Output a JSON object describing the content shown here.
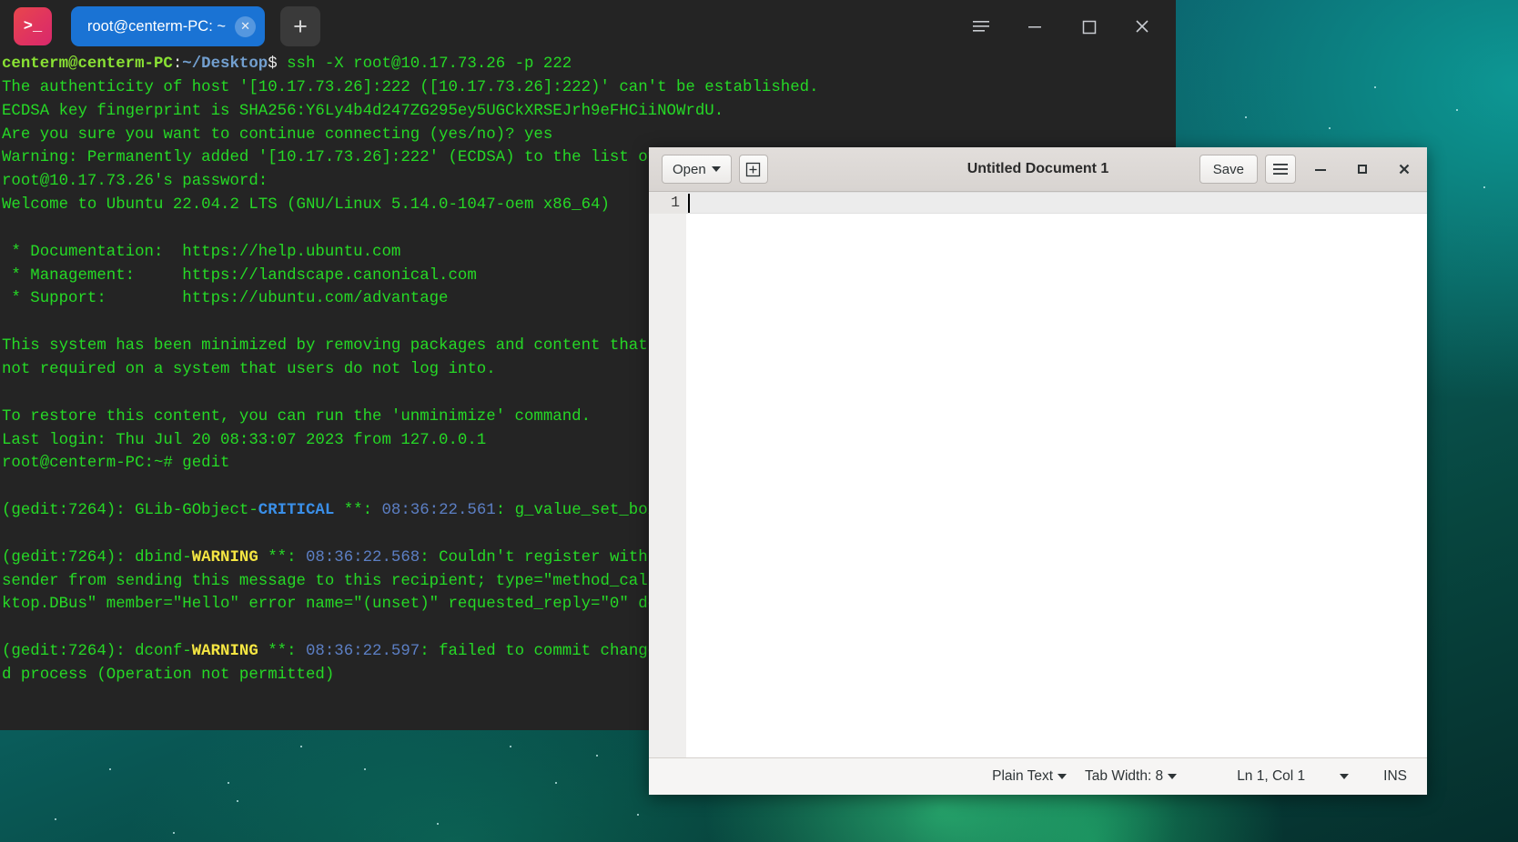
{
  "desktop": {
    "wallpaper_name": "aurora-wallpaper"
  },
  "terminal": {
    "app_icon": "terminal-icon",
    "icon_glyph": ">_",
    "tab": {
      "label": "root@centerm-PC: ~",
      "close_icon": "close-icon"
    },
    "new_tab_label": "+",
    "window_buttons": {
      "menu": "hamburger-menu-icon",
      "minimize": "minimize-icon",
      "maximize": "maximize-icon",
      "close": "close-icon"
    },
    "lines": [
      {
        "segments": [
          {
            "t": "centerm@centerm-PC",
            "c": "c-user"
          },
          {
            "t": ":",
            "c": "c-white"
          },
          {
            "t": "~/Desktop",
            "c": "c-path"
          },
          {
            "t": "$",
            "c": "c-white"
          },
          {
            "t": " ssh -X root@10.17.73.26 -p 222",
            "c": "c-green"
          }
        ]
      },
      {
        "segments": [
          {
            "t": "The authenticity of host '[10.17.73.26]:222 ([10.17.73.26]:222)' can't be established.",
            "c": "c-green"
          }
        ]
      },
      {
        "segments": [
          {
            "t": "ECDSA key fingerprint is SHA256:Y6Ly4b4d247ZG295ey5UGCkXRSEJrh9eFHCiiNOWrdU.",
            "c": "c-green"
          }
        ]
      },
      {
        "segments": [
          {
            "t": "Are you sure you want to continue connecting (yes/no)? yes",
            "c": "c-green"
          }
        ]
      },
      {
        "segments": [
          {
            "t": "Warning: Permanently added '[10.17.73.26]:222' (ECDSA) to the list of known hosts.",
            "c": "c-green"
          }
        ]
      },
      {
        "segments": [
          {
            "t": "root@10.17.73.26's password:",
            "c": "c-green"
          }
        ]
      },
      {
        "segments": [
          {
            "t": "Welcome to Ubuntu 22.04.2 LTS (GNU/Linux 5.14.0-1047-oem x86_64)",
            "c": "c-green"
          }
        ]
      },
      {
        "segments": [
          {
            "t": "",
            "c": "c-green"
          }
        ]
      },
      {
        "segments": [
          {
            "t": " * Documentation:  https://help.ubuntu.com",
            "c": "c-green"
          }
        ]
      },
      {
        "segments": [
          {
            "t": " * Management:     https://landscape.canonical.com",
            "c": "c-green"
          }
        ]
      },
      {
        "segments": [
          {
            "t": " * Support:        https://ubuntu.com/advantage",
            "c": "c-green"
          }
        ]
      },
      {
        "segments": [
          {
            "t": "",
            "c": "c-green"
          }
        ]
      },
      {
        "segments": [
          {
            "t": "This system has been minimized by removing packages and content that are",
            "c": "c-green"
          }
        ]
      },
      {
        "segments": [
          {
            "t": "not required on a system that users do not log into.",
            "c": "c-green"
          }
        ]
      },
      {
        "segments": [
          {
            "t": "",
            "c": "c-green"
          }
        ]
      },
      {
        "segments": [
          {
            "t": "To restore this content, you can run the 'unminimize' command.",
            "c": "c-green"
          }
        ]
      },
      {
        "segments": [
          {
            "t": "Last login: Thu Jul 20 08:33:07 2023 from 127.0.0.1",
            "c": "c-green"
          }
        ]
      },
      {
        "segments": [
          {
            "t": "root@centerm-PC:~# gedit",
            "c": "c-green"
          }
        ]
      },
      {
        "segments": [
          {
            "t": "",
            "c": "c-green"
          }
        ]
      },
      {
        "segments": [
          {
            "t": "(gedit:7264): GLib-GObject-",
            "c": "c-green"
          },
          {
            "t": "CRITICAL",
            "c": "c-blue-b"
          },
          {
            "t": " **: ",
            "c": "c-green"
          },
          {
            "t": "08:36:22.561",
            "c": "c-time"
          },
          {
            "t": ": g_value_set_boxed: assertion 'G_VALUE",
            "c": "c-green"
          }
        ]
      },
      {
        "segments": [
          {
            "t": "",
            "c": "c-green"
          }
        ]
      },
      {
        "segments": [
          {
            "t": "(gedit:7264): dbind-",
            "c": "c-green"
          },
          {
            "t": "WARNING",
            "c": "c-yellow-b"
          },
          {
            "t": " **: ",
            "c": "c-green"
          },
          {
            "t": "08:36:22.568",
            "c": "c-time"
          },
          {
            "t": ": Couldn't register with accessibility bus",
            "c": "c-green"
          }
        ]
      },
      {
        "segments": [
          {
            "t": "sender from sending this message to this recipient; type=\"method_call\", sender=",
            "c": "c-green"
          }
        ]
      },
      {
        "segments": [
          {
            "t": "ktop.DBus\" member=\"Hello\" error name=\"(unset)\" requested_reply=\"0\" destinat",
            "c": "c-green"
          }
        ]
      },
      {
        "segments": [
          {
            "t": "",
            "c": "c-green"
          }
        ]
      },
      {
        "segments": [
          {
            "t": "(gedit:7264): dconf-",
            "c": "c-green"
          },
          {
            "t": "WARNING",
            "c": "c-yellow-b"
          },
          {
            "t": " **: ",
            "c": "c-green"
          },
          {
            "t": "08:36:22.597",
            "c": "c-time"
          },
          {
            "t": ": failed to commit changes to dconf",
            "c": "c-green"
          }
        ]
      },
      {
        "segments": [
          {
            "t": "d process (Operation not permitted)",
            "c": "c-green"
          }
        ]
      }
    ]
  },
  "gedit": {
    "title": "Untitled Document 1",
    "open_label": "Open",
    "new_doc_icon": "new-document-icon",
    "save_label": "Save",
    "hamburger_icon": "hamburger-menu-icon",
    "minimize_icon": "minimize-icon",
    "maximize_icon": "maximize-icon",
    "close_icon": "close-icon",
    "gutter_first_line": "1",
    "document_text": "",
    "status": {
      "language": "Plain Text",
      "tab_width": "Tab Width: 8",
      "position": "Ln 1, Col 1",
      "insert_mode": "INS"
    }
  },
  "colors": {
    "terminal_bg": "#242424",
    "terminal_green": "#26d926",
    "tab_blue": "#1a73d4",
    "warning_yellow": "#f5e642",
    "critical_blue": "#3a8fe8",
    "gedit_header": "#ded9d6"
  }
}
